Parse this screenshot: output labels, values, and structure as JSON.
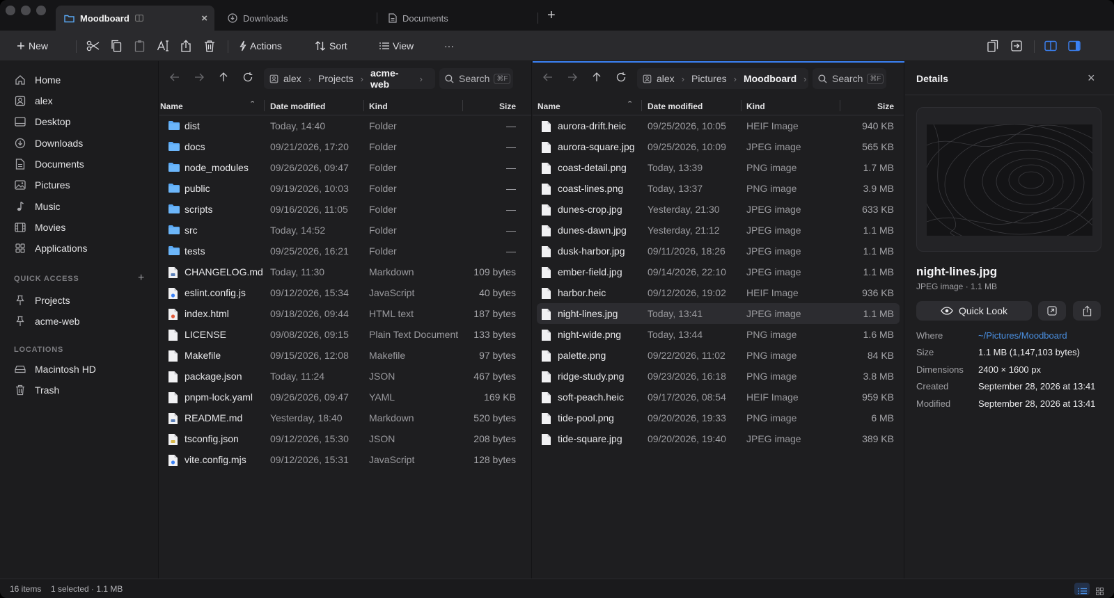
{
  "tabs": [
    {
      "label": "Moodboard",
      "active": true
    },
    {
      "label": "Downloads",
      "active": false
    },
    {
      "label": "Documents",
      "active": false
    }
  ],
  "tab_close": "×",
  "tab_new": "+",
  "toolbar": {
    "new_label": "New",
    "actions_label": "Actions",
    "sort_label": "Sort",
    "view_label": "View",
    "more_label": "···"
  },
  "sidebar": {
    "items": [
      {
        "label": "Home",
        "icon": "home-icon"
      },
      {
        "label": "alex",
        "icon": "user-icon"
      },
      {
        "label": "Desktop",
        "icon": "desktop-icon"
      },
      {
        "label": "Downloads",
        "icon": "download-icon"
      },
      {
        "label": "Documents",
        "icon": "document-icon"
      },
      {
        "label": "Pictures",
        "icon": "picture-icon"
      },
      {
        "label": "Music",
        "icon": "music-icon"
      },
      {
        "label": "Movies",
        "icon": "film-icon"
      },
      {
        "label": "Applications",
        "icon": "apps-icon"
      }
    ],
    "quick_access_heading": "QUICK ACCESS",
    "quick_access_add": "+",
    "quick_access": [
      {
        "label": "Projects",
        "icon": "pin-icon"
      },
      {
        "label": "acme-web",
        "icon": "pin-icon"
      }
    ],
    "locations_heading": "LOCATIONS",
    "locations": [
      {
        "label": "Macintosh HD",
        "icon": "drive-icon"
      },
      {
        "label": "Trash",
        "icon": "trash-icon"
      }
    ]
  },
  "columns": {
    "name": "Name",
    "modified": "Date modified",
    "kind": "Kind",
    "size": "Size"
  },
  "left_pane": {
    "breadcrumb": [
      "alex",
      "Projects",
      "acme-web"
    ],
    "search_placeholder": "Search",
    "search_shortcut": "⌘F",
    "rows": [
      {
        "name": "dist",
        "modified": "Today, 14:40",
        "kind": "Folder",
        "size": "—",
        "type": "folder"
      },
      {
        "name": "docs",
        "modified": "09/21/2026, 17:20",
        "kind": "Folder",
        "size": "—",
        "type": "folder"
      },
      {
        "name": "node_modules",
        "modified": "09/26/2026, 09:47",
        "kind": "Folder",
        "size": "—",
        "type": "folder"
      },
      {
        "name": "public",
        "modified": "09/19/2026, 10:03",
        "kind": "Folder",
        "size": "—",
        "type": "folder"
      },
      {
        "name": "scripts",
        "modified": "09/16/2026, 11:05",
        "kind": "Folder",
        "size": "—",
        "type": "folder"
      },
      {
        "name": "src",
        "modified": "Today, 14:52",
        "kind": "Folder",
        "size": "—",
        "type": "folder"
      },
      {
        "name": "tests",
        "modified": "09/25/2026, 16:21",
        "kind": "Folder",
        "size": "—",
        "type": "folder"
      },
      {
        "name": "CHANGELOG.md",
        "modified": "Today, 11:30",
        "kind": "Markdown",
        "size": "109 bytes",
        "type": "md"
      },
      {
        "name": "eslint.config.js",
        "modified": "09/12/2026, 15:34",
        "kind": "JavaScript",
        "size": "40 bytes",
        "type": "js"
      },
      {
        "name": "index.html",
        "modified": "09/18/2026, 09:44",
        "kind": "HTML text",
        "size": "187 bytes",
        "type": "html"
      },
      {
        "name": "LICENSE",
        "modified": "09/08/2026, 09:15",
        "kind": "Plain Text Document",
        "size": "133 bytes",
        "type": "file"
      },
      {
        "name": "Makefile",
        "modified": "09/15/2026, 12:08",
        "kind": "Makefile",
        "size": "97 bytes",
        "type": "file"
      },
      {
        "name": "package.json",
        "modified": "Today, 11:24",
        "kind": "JSON",
        "size": "467 bytes",
        "type": "file"
      },
      {
        "name": "pnpm-lock.yaml",
        "modified": "09/26/2026, 09:47",
        "kind": "YAML",
        "size": "169 KB",
        "type": "file"
      },
      {
        "name": "README.md",
        "modified": "Yesterday, 18:40",
        "kind": "Markdown",
        "size": "520 bytes",
        "type": "md"
      },
      {
        "name": "tsconfig.json",
        "modified": "09/12/2026, 15:30",
        "kind": "JSON",
        "size": "208 bytes",
        "type": "json"
      },
      {
        "name": "vite.config.mjs",
        "modified": "09/12/2026, 15:31",
        "kind": "JavaScript",
        "size": "128 bytes",
        "type": "js"
      }
    ]
  },
  "right_pane": {
    "breadcrumb": [
      "alex",
      "Pictures",
      "Moodboard"
    ],
    "search_placeholder": "Search",
    "search_shortcut": "⌘F",
    "rows": [
      {
        "name": "aurora-drift.heic",
        "modified": "09/25/2026, 10:05",
        "kind": "HEIF Image",
        "size": "940 KB"
      },
      {
        "name": "aurora-square.jpg",
        "modified": "09/25/2026, 10:09",
        "kind": "JPEG image",
        "size": "565 KB"
      },
      {
        "name": "coast-detail.png",
        "modified": "Today, 13:39",
        "kind": "PNG image",
        "size": "1.7 MB"
      },
      {
        "name": "coast-lines.png",
        "modified": "Today, 13:37",
        "kind": "PNG image",
        "size": "3.9 MB"
      },
      {
        "name": "dunes-crop.jpg",
        "modified": "Yesterday, 21:30",
        "kind": "JPEG image",
        "size": "633 KB"
      },
      {
        "name": "dunes-dawn.jpg",
        "modified": "Yesterday, 21:12",
        "kind": "JPEG image",
        "size": "1.1 MB"
      },
      {
        "name": "dusk-harbor.jpg",
        "modified": "09/11/2026, 18:26",
        "kind": "JPEG image",
        "size": "1.1 MB"
      },
      {
        "name": "ember-field.jpg",
        "modified": "09/14/2026, 22:10",
        "kind": "JPEG image",
        "size": "1.1 MB"
      },
      {
        "name": "harbor.heic",
        "modified": "09/12/2026, 19:02",
        "kind": "HEIF Image",
        "size": "936 KB"
      },
      {
        "name": "night-lines.jpg",
        "modified": "Today, 13:41",
        "kind": "JPEG image",
        "size": "1.1 MB",
        "selected": true
      },
      {
        "name": "night-wide.png",
        "modified": "Today, 13:44",
        "kind": "PNG image",
        "size": "1.6 MB"
      },
      {
        "name": "palette.png",
        "modified": "09/22/2026, 11:02",
        "kind": "PNG image",
        "size": "84 KB"
      },
      {
        "name": "ridge-study.png",
        "modified": "09/23/2026, 16:18",
        "kind": "PNG image",
        "size": "3.8 MB"
      },
      {
        "name": "soft-peach.heic",
        "modified": "09/17/2026, 08:54",
        "kind": "HEIF Image",
        "size": "959 KB"
      },
      {
        "name": "tide-pool.png",
        "modified": "09/20/2026, 19:33",
        "kind": "PNG image",
        "size": "6 MB"
      },
      {
        "name": "tide-square.jpg",
        "modified": "09/20/2026, 19:40",
        "kind": "JPEG image",
        "size": "389 KB"
      }
    ]
  },
  "details": {
    "title": "Details",
    "close": "×",
    "filename": "night-lines.jpg",
    "subtitle": "JPEG image · 1.1 MB",
    "quick_look_label": "Quick Look",
    "fields": [
      {
        "key": "Where",
        "value": "~/Pictures/Moodboard",
        "link": true
      },
      {
        "key": "Size",
        "value": "1.1 MB (1,147,103 bytes)"
      },
      {
        "key": "Dimensions",
        "value": "2400 × 1600 px"
      },
      {
        "key": "Created",
        "value": "September 28, 2026 at 13:41"
      },
      {
        "key": "Modified",
        "value": "September 28, 2026 at 13:41"
      }
    ]
  },
  "status": {
    "items": "16 items",
    "selection": "1 selected · 1.1 MB"
  },
  "colors": {
    "accent": "#3b82f6",
    "folder": "#5aa9f5",
    "link": "#4a90e2"
  }
}
